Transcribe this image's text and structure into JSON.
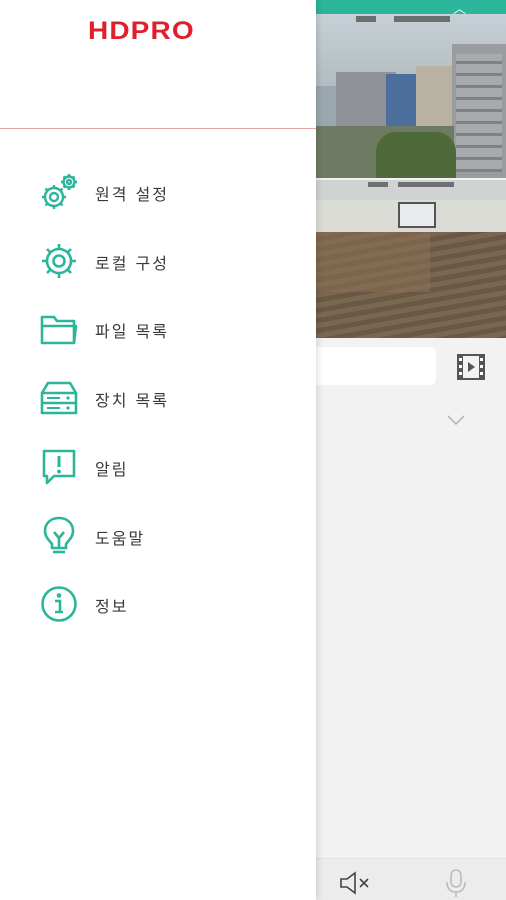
{
  "colors": {
    "accent": "#2bb59a",
    "logo": "#e01f2c",
    "divider": "#e8a5a9"
  },
  "drawer": {
    "logo_text": "HDPRO",
    "menu": [
      {
        "label": "원격 설정",
        "icon": "gears-icon"
      },
      {
        "label": "로컬 구성",
        "icon": "gear-icon"
      },
      {
        "label": "파일 목록",
        "icon": "folder-icon"
      },
      {
        "label": "장치 목록",
        "icon": "server-icon"
      },
      {
        "label": "알림",
        "icon": "alert-icon"
      },
      {
        "label": "도움말",
        "icon": "lightbulb-icon"
      },
      {
        "label": "정보",
        "icon": "info-icon"
      }
    ]
  },
  "background": {
    "top_bar_icon": "chevron-up-icon",
    "toolbar_icons": [
      "film-icon",
      "chevron-down-icon"
    ],
    "bottom_icons": [
      "speaker-mute-icon",
      "microphone-icon"
    ]
  }
}
